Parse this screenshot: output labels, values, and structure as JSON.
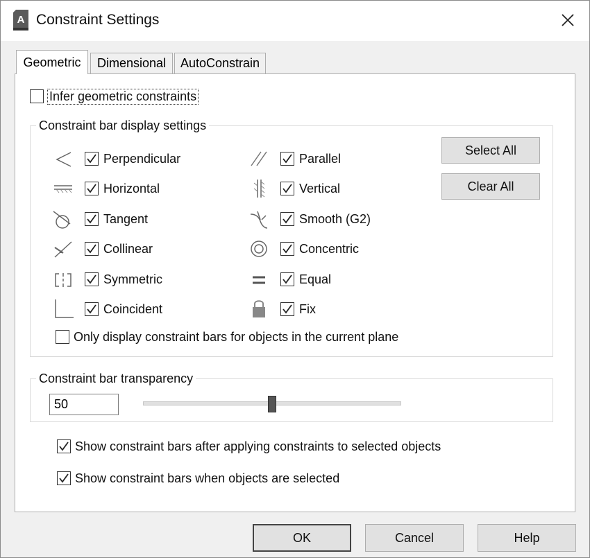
{
  "window": {
    "title": "Constraint Settings"
  },
  "tabs": [
    {
      "label": "Geometric",
      "active": true
    },
    {
      "label": "Dimensional",
      "active": false
    },
    {
      "label": "AutoConstrain",
      "active": false
    }
  ],
  "infer": {
    "label": "Infer geometric constraints",
    "checked": false
  },
  "bar_display": {
    "title": "Constraint bar display settings",
    "left_items": [
      {
        "label": "Perpendicular",
        "icon": "perpendicular-icon",
        "checked": true
      },
      {
        "label": "Horizontal",
        "icon": "horizontal-icon",
        "checked": true
      },
      {
        "label": "Tangent",
        "icon": "tangent-icon",
        "checked": true
      },
      {
        "label": "Collinear",
        "icon": "collinear-icon",
        "checked": true
      },
      {
        "label": "Symmetric",
        "icon": "symmetric-icon",
        "checked": true
      },
      {
        "label": "Coincident",
        "icon": "coincident-icon",
        "checked": true
      }
    ],
    "right_items": [
      {
        "label": "Parallel",
        "icon": "parallel-icon",
        "checked": true
      },
      {
        "label": "Vertical",
        "icon": "vertical-icon",
        "checked": true
      },
      {
        "label": "Smooth (G2)",
        "icon": "smooth-icon",
        "checked": true
      },
      {
        "label": "Concentric",
        "icon": "concentric-icon",
        "checked": true
      },
      {
        "label": "Equal",
        "icon": "equal-icon",
        "checked": true
      },
      {
        "label": "Fix",
        "icon": "lock-icon",
        "checked": true
      }
    ],
    "select_all": "Select All",
    "clear_all": "Clear All",
    "current_plane": {
      "label": "Only display constraint bars for objects in the current plane",
      "checked": false
    }
  },
  "transparency": {
    "title": "Constraint bar transparency",
    "value": "50",
    "slider_fraction": 0.5
  },
  "options": [
    {
      "label": "Show constraint bars after applying constraints to selected objects",
      "checked": true
    },
    {
      "label": "Show constraint bars when objects are selected",
      "checked": true
    }
  ],
  "footer": {
    "ok": "OK",
    "cancel": "Cancel",
    "help": "Help"
  }
}
